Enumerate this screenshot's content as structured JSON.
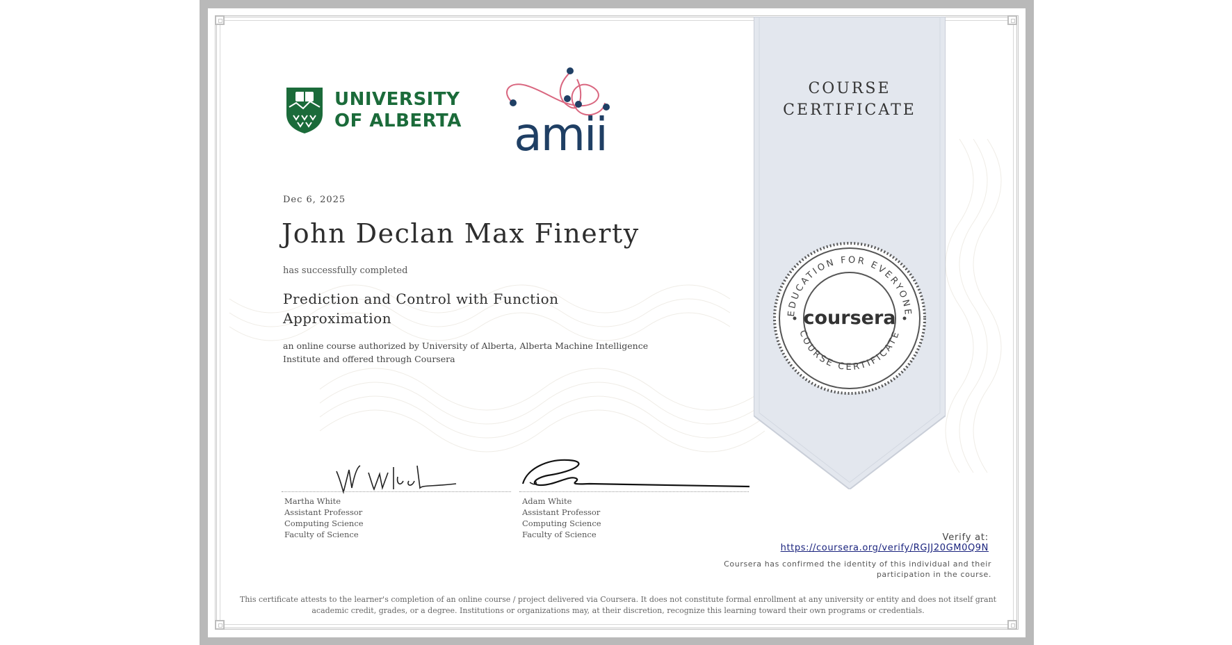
{
  "certificate": {
    "ribbon_title_line1": "COURSE",
    "ribbon_title_line2": "CERTIFICATE",
    "issuer_logo_line1": "UNIVERSITY",
    "issuer_logo_line2": "OF ALBERTA",
    "partner_logo_text": "amii",
    "date": "Dec 6, 2025",
    "recipient_name": "John Declan Max Finerty",
    "completed_text": "has successfully completed",
    "course_title": "Prediction and Control with Function Approximation",
    "description": "an online course authorized by University of Alberta, Alberta Machine Intelligence Institute and offered through Coursera"
  },
  "seal": {
    "brand": "coursera",
    "ring_top": "EDUCATION FOR EVERYONE",
    "ring_bottom": "COURSE CERTIFICATE"
  },
  "signers": [
    {
      "name": "Martha White",
      "title": "Assistant Professor",
      "department": "Computing Science",
      "faculty": "Faculty of Science"
    },
    {
      "name": "Adam White",
      "title": "Assistant Professor",
      "department": "Computing Science",
      "faculty": "Faculty of Science"
    }
  ],
  "verification": {
    "label": "Verify at:",
    "url": "https://coursera.org/verify/RGJJ20GM0Q9N",
    "identity_note": "Coursera has confirmed the identity of this individual and their participation in the course."
  },
  "disclaimer": "This certificate attests to the learner's completion of an online course / project delivered via Coursera. It does not constitute formal enrollment at any university or entity and does not itself grant academic credit, grades, or a degree. Institutions or organizations may, at their discretion, recognize this learning toward their own programs or credentials.",
  "colors": {
    "ualberta_green": "#1b6b3a",
    "amii_navy": "#1f3f64",
    "amii_pink": "#d9667f",
    "ribbon_fill": "#e3e7ee",
    "link": "#1a237e"
  }
}
